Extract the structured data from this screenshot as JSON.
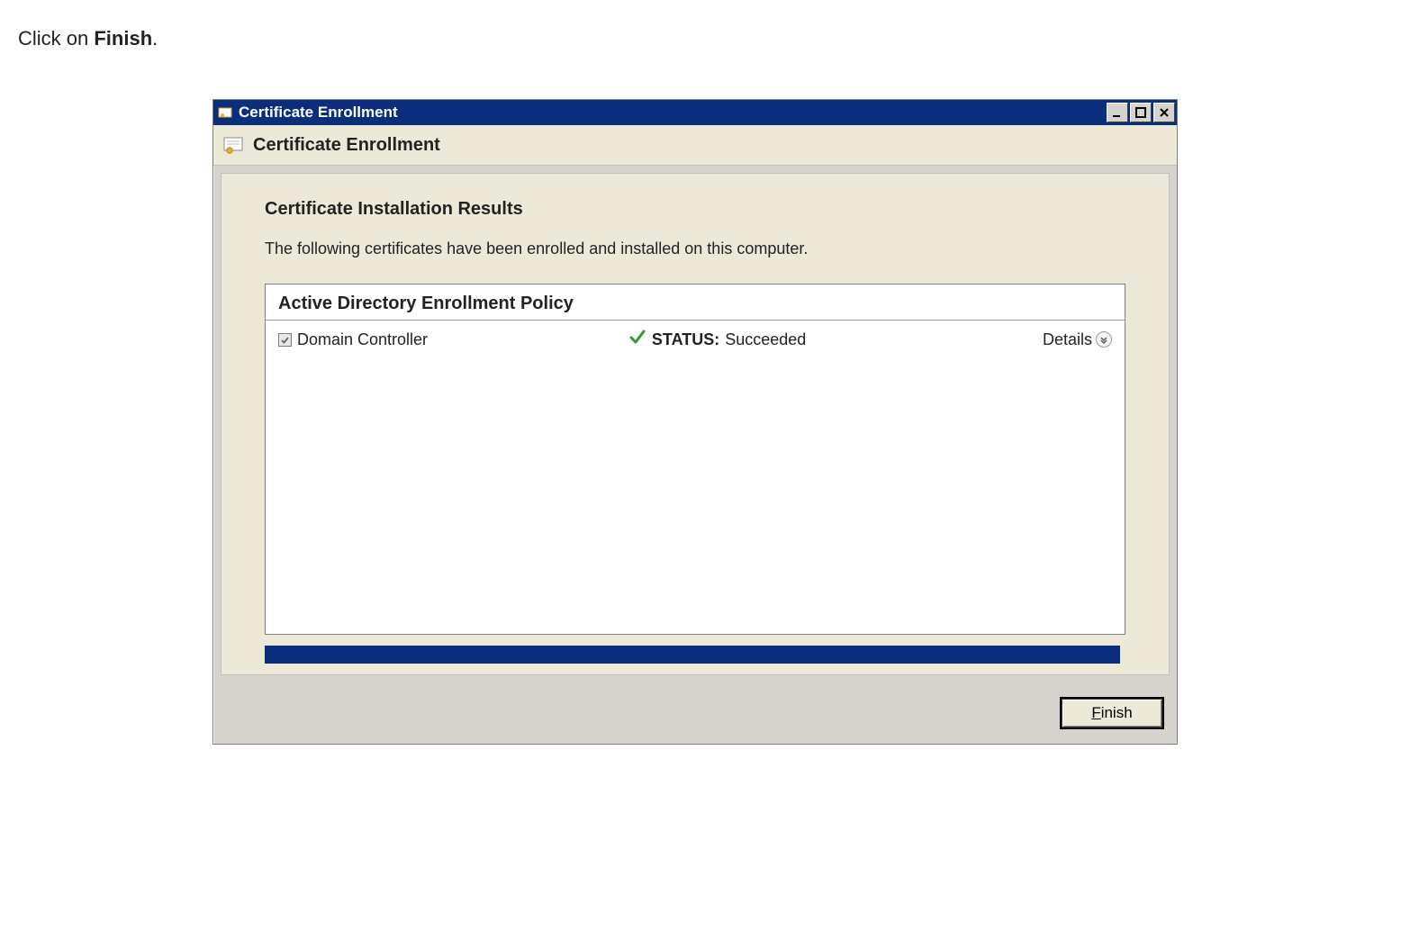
{
  "instruction": {
    "prefix": "Click on ",
    "bold": "Finish",
    "suffix": "."
  },
  "window": {
    "title": "Certificate Enrollment",
    "wizard_title": "Certificate Enrollment",
    "section_heading": "Certificate Installation Results",
    "section_desc": "The following certificates have been enrolled and installed on this computer.",
    "policy_title": "Active Directory Enrollment Policy",
    "row": {
      "template_name": "Domain Controller",
      "status_label": "STATUS:",
      "status_value": "Succeeded",
      "details_label": "Details"
    },
    "finish_label_accel": "F",
    "finish_label_rest": "inish"
  },
  "colors": {
    "titlebar": "#0b2e7c",
    "panel": "#ece9d8",
    "success": "#2a9d2a"
  }
}
